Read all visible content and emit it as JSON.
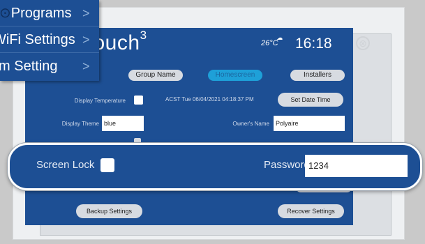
{
  "menu": {
    "items": [
      {
        "label": "Programs",
        "chevron": ">"
      },
      {
        "label": "WiFi Settings",
        "chevron": ">"
      },
      {
        "label": "System Setting",
        "chevron": ">"
      }
    ]
  },
  "header": {
    "brand": "Touch",
    "brand_sup": "3",
    "outside_temp": "26°C",
    "time": "16:18"
  },
  "tabs": [
    "Group Name",
    "Homescreen",
    "Installers"
  ],
  "rows": {
    "display_temperature_label": "Display Temperature",
    "datetime": "ACST Tue 06/04/2021 04:18:37 PM",
    "set_date_time": "Set Date Time",
    "display_theme_label": "Display Theme",
    "display_theme_value": "blue",
    "owners_name_label": "Owner's Name",
    "owners_name_value": "Polyaire"
  },
  "screen_lock": {
    "label": "Screen Lock",
    "password_label": "Password",
    "password_value": "1234"
  },
  "footer": {
    "backup": "Backup Settings",
    "recover": "Recover Settings"
  },
  "colors": {
    "screen_blue": "#1d4f94",
    "active_tab": "#1ea0d8"
  }
}
